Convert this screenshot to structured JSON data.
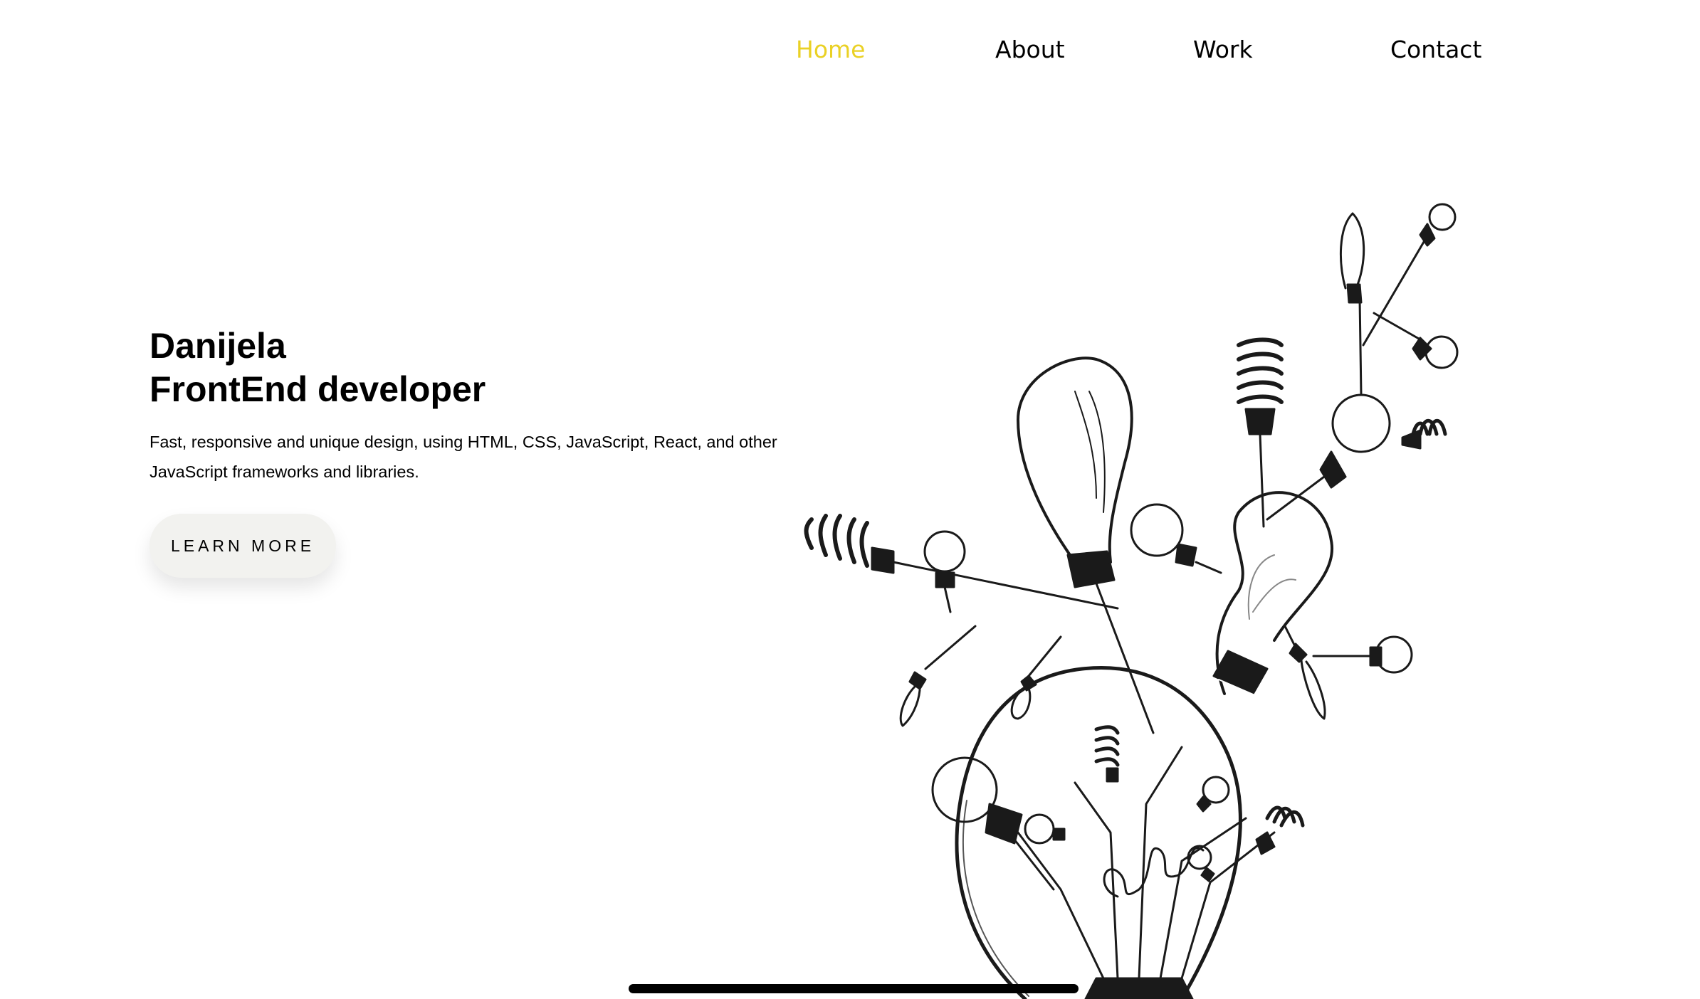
{
  "nav": {
    "items": [
      {
        "label": "Home",
        "active": true
      },
      {
        "label": "About",
        "active": false
      },
      {
        "label": "Work",
        "active": false
      },
      {
        "label": "Contact",
        "active": false
      }
    ]
  },
  "hero": {
    "name": "Danijela",
    "role": "FrontEnd developer",
    "description": "Fast, responsive and unique design, using HTML, CSS, JavaScript, React, and other JavaScript frameworks and libraries.",
    "cta_label": "LEARN MORE"
  },
  "illustration": {
    "icon": "lightbulb-tree-illustration"
  },
  "colors": {
    "accent": "#ead125",
    "text": "#000000",
    "button_bg": "#f2f2ef",
    "background": "#ffffff"
  }
}
